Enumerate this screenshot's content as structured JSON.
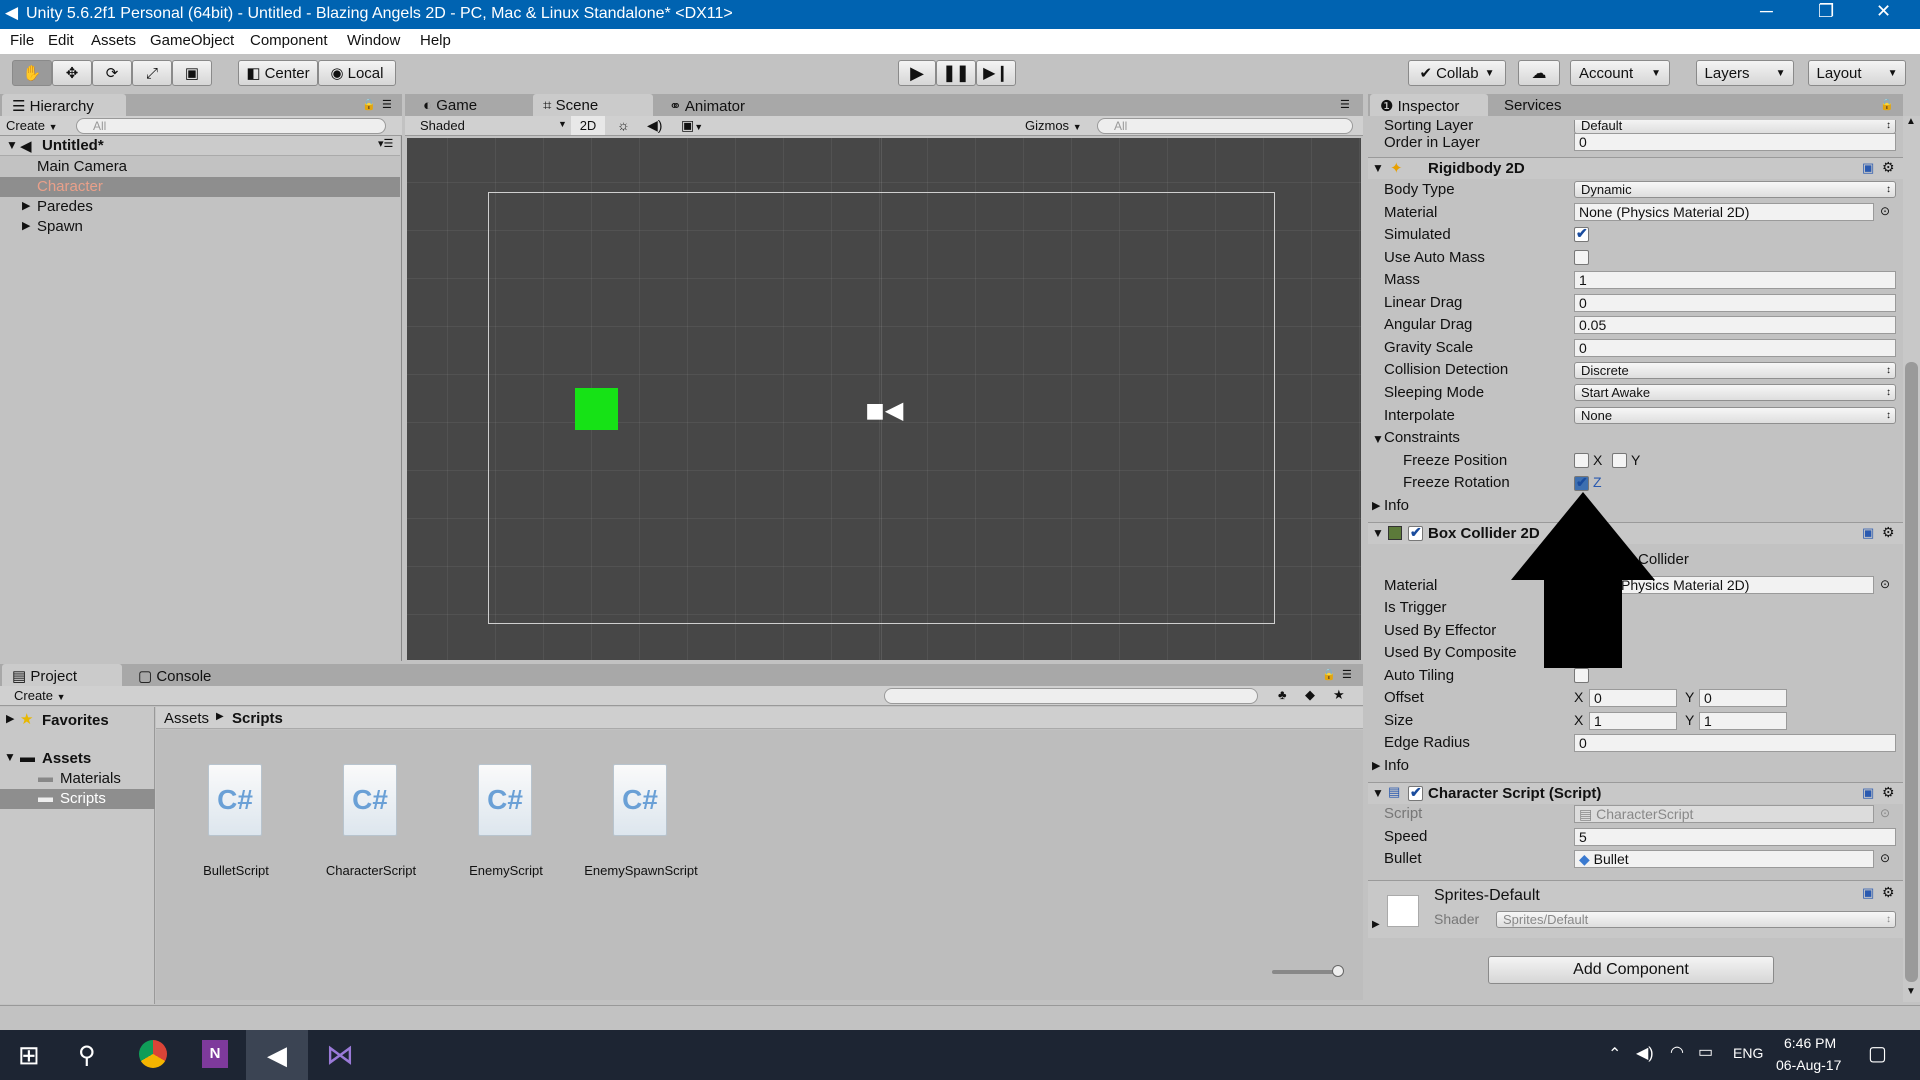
{
  "window": {
    "title": "Unity 5.6.2f1 Personal (64bit) - Untitled - Blazing Angels 2D - PC, Mac & Linux Standalone* <DX11>",
    "minimize": "─",
    "maximize": "❐",
    "close": "✕"
  },
  "menu": [
    "File",
    "Edit",
    "Assets",
    "GameObject",
    "Component",
    "Window",
    "Help"
  ],
  "toolbar": {
    "center": "Center",
    "local": "Local",
    "collab": "Collab",
    "account": "Account",
    "layers": "Layers",
    "layout": "Layout"
  },
  "hierarchy": {
    "tab": "Hierarchy",
    "create": "Create",
    "search_placeholder": "All",
    "scene": "Untitled*",
    "items": [
      "Main Camera",
      "Character",
      "Paredes",
      "Spawn"
    ]
  },
  "scene_view": {
    "tabs": [
      "Game",
      "Scene",
      "Animator"
    ],
    "shading": "Shaded",
    "mode2d": "2D",
    "gizmos": "Gizmos",
    "search_placeholder": "All"
  },
  "project": {
    "tabs": [
      "Project",
      "Console"
    ],
    "create": "Create",
    "favorites": "Favorites",
    "assets": "Assets",
    "folders": [
      "Materials",
      "Scripts"
    ],
    "breadcrumb": [
      "Assets",
      "Scripts"
    ],
    "files": [
      "BulletScript",
      "CharacterScript",
      "EnemyScript",
      "EnemySpawnScript"
    ],
    "file_icon": "C#"
  },
  "inspector": {
    "tabs": [
      "Inspector",
      "Services"
    ],
    "top": [
      {
        "label": "Sorting Layer",
        "value": "Default"
      },
      {
        "label": "Order in Layer",
        "value": "0"
      }
    ],
    "rigidbody": {
      "title": "Rigidbody 2D",
      "body_type": [
        "Body Type",
        "Dynamic"
      ],
      "material": [
        "Material",
        "None (Physics Material 2D)"
      ],
      "simulated": "Simulated",
      "use_auto_mass": "Use Auto Mass",
      "mass": [
        "Mass",
        "1"
      ],
      "linear_drag": [
        "Linear Drag",
        "0"
      ],
      "angular_drag": [
        "Angular Drag",
        "0.05"
      ],
      "gravity_scale": [
        "Gravity Scale",
        "0"
      ],
      "collision": [
        "Collision Detection",
        "Discrete"
      ],
      "sleeping": [
        "Sleeping Mode",
        "Start Awake"
      ],
      "interpolate": [
        "Interpolate",
        "None"
      ],
      "constraints": "Constraints",
      "freeze_position": "Freeze Position",
      "freeze_rotation": "Freeze Rotation",
      "x": "X",
      "y": "Y",
      "z": "Z",
      "info": "Info",
      "simulated_checked": true,
      "auto_mass_checked": false,
      "freeze_z_checked": true
    },
    "box_collider": {
      "title": "Box Collider 2D",
      "edit": "Edit Collider",
      "material": [
        "Material",
        "None (Physics Material 2D)"
      ],
      "is_trigger": "Is Trigger",
      "used_by_effector": "Used By Effector",
      "used_by_composite": "Used By Composite",
      "auto_tiling": "Auto Tiling",
      "offset": "Offset",
      "offset_x": "0",
      "offset_y": "0",
      "size": "Size",
      "size_x": "1",
      "size_y": "1",
      "edge_radius": [
        "Edge Radius",
        "0"
      ],
      "info": "Info"
    },
    "script": {
      "title": "Character Script (Script)",
      "script": [
        "Script",
        "CharacterScript"
      ],
      "speed": [
        "Speed",
        "5"
      ],
      "bullet": [
        "Bullet",
        "Bullet"
      ]
    },
    "material": {
      "name": "Sprites-Default",
      "shader_label": "Shader",
      "shader": "Sprites/Default"
    },
    "add_component": "Add Component"
  },
  "taskbar": {
    "time": "6:46 PM",
    "date": "06-Aug-17",
    "lang": "ENG"
  },
  "colors": {
    "title_bar": "#0063b1",
    "selection": "#3d6fb0",
    "character_sprite": "#16e216",
    "scene_bg": "#474747"
  }
}
